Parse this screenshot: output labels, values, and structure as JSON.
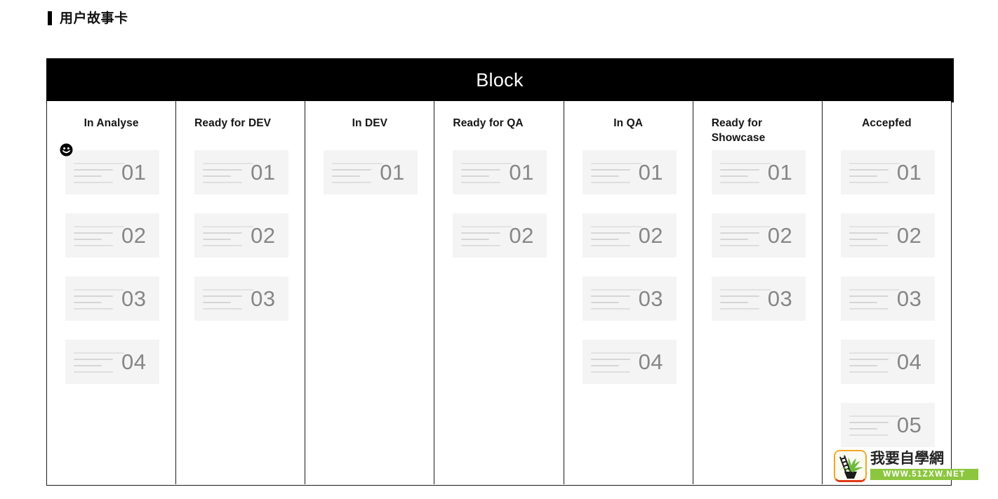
{
  "page": {
    "title": "用户故事卡"
  },
  "board": {
    "header_title": "Block",
    "columns": [
      {
        "title": "In Analyse",
        "centered": true,
        "cards": [
          "01",
          "02",
          "03",
          "04"
        ],
        "cursor_on_first_card": true
      },
      {
        "title": "Ready for DEV",
        "centered": false,
        "cards": [
          "01",
          "02",
          "03"
        ],
        "cursor_on_first_card": false
      },
      {
        "title": "In DEV",
        "centered": true,
        "cards": [
          "01"
        ],
        "cursor_on_first_card": false
      },
      {
        "title": "Ready for QA",
        "centered": false,
        "cards": [
          "01",
          "02"
        ],
        "cursor_on_first_card": false
      },
      {
        "title": "In QA",
        "centered": true,
        "cards": [
          "01",
          "02",
          "03",
          "04"
        ],
        "cursor_on_first_card": false
      },
      {
        "title": "Ready for Showcase",
        "centered": false,
        "cards": [
          "01",
          "02",
          "03"
        ],
        "cursor_on_first_card": false
      },
      {
        "title": "Accepfed",
        "centered": true,
        "cards": [
          "01",
          "02",
          "03",
          "04",
          "05"
        ],
        "cursor_on_first_card": false
      }
    ]
  },
  "watermark": {
    "site_name": "我要自學網",
    "url": "WWW.51ZXW.NET"
  },
  "colors": {
    "header_bg": "#000000",
    "header_text": "#ffffff",
    "card_bg": "#f4f4f4",
    "card_number": "#868686",
    "border": "#1b1b1b",
    "watermark_green": "#8cc63f",
    "watermark_orange": "#f5a623"
  },
  "icons": {
    "cursor": "smiley-face-cursor",
    "title_mark": "vertical-bar-mark"
  }
}
